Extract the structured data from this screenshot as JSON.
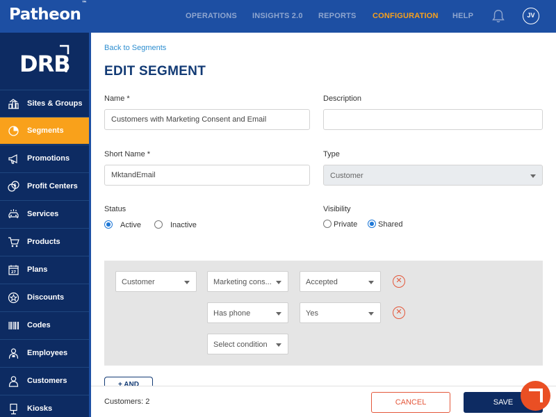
{
  "brand": {
    "name": "Patheon",
    "mark": "™"
  },
  "nav": [
    {
      "label": "OPERATIONS",
      "active": false
    },
    {
      "label": "INSIGHTS 2.0",
      "active": false
    },
    {
      "label": "REPORTS",
      "active": false
    },
    {
      "label": "CONFIGURATION",
      "active": true
    },
    {
      "label": "HELP",
      "active": false
    }
  ],
  "user": {
    "initials": "JV"
  },
  "sidebar": {
    "logo": "DRB",
    "items": [
      {
        "label": "Sites & Groups",
        "icon": "sites-icon"
      },
      {
        "label": "Segments",
        "icon": "pie-chart-icon",
        "active": true
      },
      {
        "label": "Promotions",
        "icon": "megaphone-icon"
      },
      {
        "label": "Profit Centers",
        "icon": "coins-icon"
      },
      {
        "label": "Services",
        "icon": "car-wash-icon"
      },
      {
        "label": "Products",
        "icon": "cart-icon"
      },
      {
        "label": "Plans",
        "icon": "calendar-icon"
      },
      {
        "label": "Discounts",
        "icon": "star-badge-icon"
      },
      {
        "label": "Codes",
        "icon": "barcode-icon"
      },
      {
        "label": "Employees",
        "icon": "employee-icon"
      },
      {
        "label": "Customers",
        "icon": "customer-icon"
      },
      {
        "label": "Kiosks",
        "icon": "kiosk-icon"
      }
    ]
  },
  "page": {
    "back_link": "Back to Segments",
    "title": "EDIT SEGMENT"
  },
  "form": {
    "name": {
      "label": "Name *",
      "value": "Customers with Marketing Consent and Email"
    },
    "description": {
      "label": "Description",
      "value": ""
    },
    "short_name": {
      "label": "Short Name *",
      "value": "MktandEmail"
    },
    "type": {
      "label": "Type",
      "value": "Customer"
    },
    "status": {
      "label": "Status",
      "options": [
        "Active",
        "Inactive"
      ],
      "selected": "Active"
    },
    "visibility": {
      "label": "Visibility",
      "options": [
        "Private",
        "Shared"
      ],
      "selected": "Shared"
    }
  },
  "conditions": {
    "rows": [
      {
        "entity": "Customer",
        "field": "Marketing cons...",
        "value": "Accepted"
      },
      {
        "field": "Has phone",
        "value": "Yes"
      },
      {
        "field": "Select condition"
      }
    ],
    "and_button": "+ AND"
  },
  "footer": {
    "count": "Customers: 2",
    "cancel": "CANCEL",
    "save": "SAVE"
  },
  "colors": {
    "topbar": "#1d4fa3",
    "sidebar": "#0d2b62",
    "accent": "#f9a11b",
    "danger": "#e4573a",
    "link": "#2d8ed0"
  }
}
